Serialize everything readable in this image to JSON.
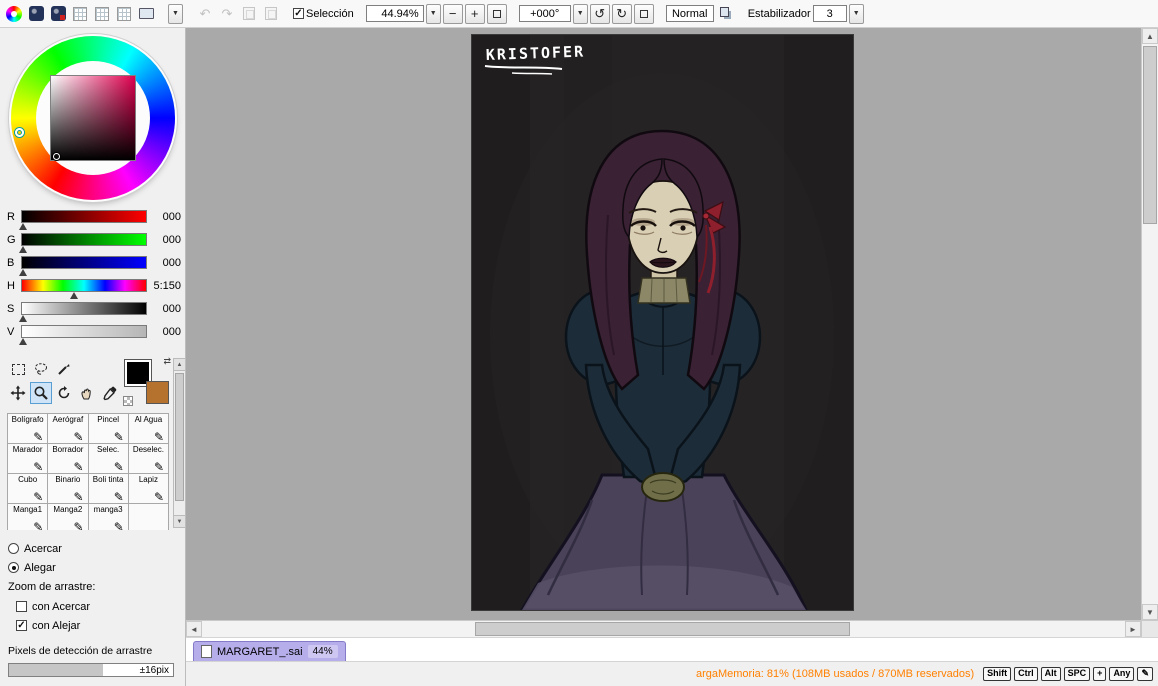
{
  "icons": {
    "dropdown": "▼",
    "up_arrow": "▲",
    "down_arrow": "▼",
    "left_arrow": "◄",
    "right_arrow": "►",
    "undo": "↶",
    "redo": "↷",
    "minus": "−",
    "plus": "+",
    "rotate_ccw": "↺",
    "rotate_cw": "↻",
    "check": "✓",
    "pen": "✎",
    "swap": "⇄",
    "dpad": "+"
  },
  "toolbar": {
    "selection_label": "Selección",
    "zoom_value": "44.94%",
    "angle_value": "+000°",
    "blend_mode": "Normal",
    "stabilizer_label": "Estabilizador",
    "stabilizer_value": "3"
  },
  "color_panel": {
    "sliders": [
      {
        "label": "R",
        "value": "000"
      },
      {
        "label": "G",
        "value": "000"
      },
      {
        "label": "B",
        "value": "000"
      },
      {
        "label": "H",
        "value": "5:150"
      },
      {
        "label": "S",
        "value": "000"
      },
      {
        "label": "V",
        "value": "000"
      }
    ]
  },
  "tools": {
    "items": [
      {
        "label": "Bolígrafo"
      },
      {
        "label": "Aerógraf"
      },
      {
        "label": "Pincel"
      },
      {
        "label": "Al Agua"
      },
      {
        "label": "Marador"
      },
      {
        "label": "Borrador"
      },
      {
        "label": "Selec."
      },
      {
        "label": "Deselec."
      },
      {
        "label": "Cubo"
      },
      {
        "label": "Binario"
      },
      {
        "label": "Boli tinta"
      },
      {
        "label": "Lapiz"
      },
      {
        "label": "Manga1"
      },
      {
        "label": "Manga2"
      },
      {
        "label": "manga3"
      }
    ]
  },
  "view_options": {
    "radio_zoom_in": "Acercar",
    "radio_zoom_out": "Alegar",
    "drag_zoom_label": "Zoom de arrastre:",
    "check_zoom_in": "con Acercar",
    "check_zoom_out": "con Alejar",
    "drag_pixels_label": "Pixels de detección de arrastre",
    "drag_pixels_value": "±16pix"
  },
  "canvas": {
    "signature": "KRISTOFER"
  },
  "tab": {
    "filename": "MARGARET_.sai",
    "zoom": "44%"
  },
  "status": {
    "memory": "argaMemoria: 81% (108MB usados / 870MB reservados)",
    "keys": [
      "Shift",
      "Ctrl",
      "Alt",
      "SPC"
    ],
    "any_label": "Any"
  },
  "colors": {
    "tab_accent": "#b6aeea",
    "memory_text": "#ff8000",
    "selected_tool_highlight": "#cfe4f7",
    "canvas_backdrop": "#a9a9a9",
    "artwork_background": "#242223"
  }
}
